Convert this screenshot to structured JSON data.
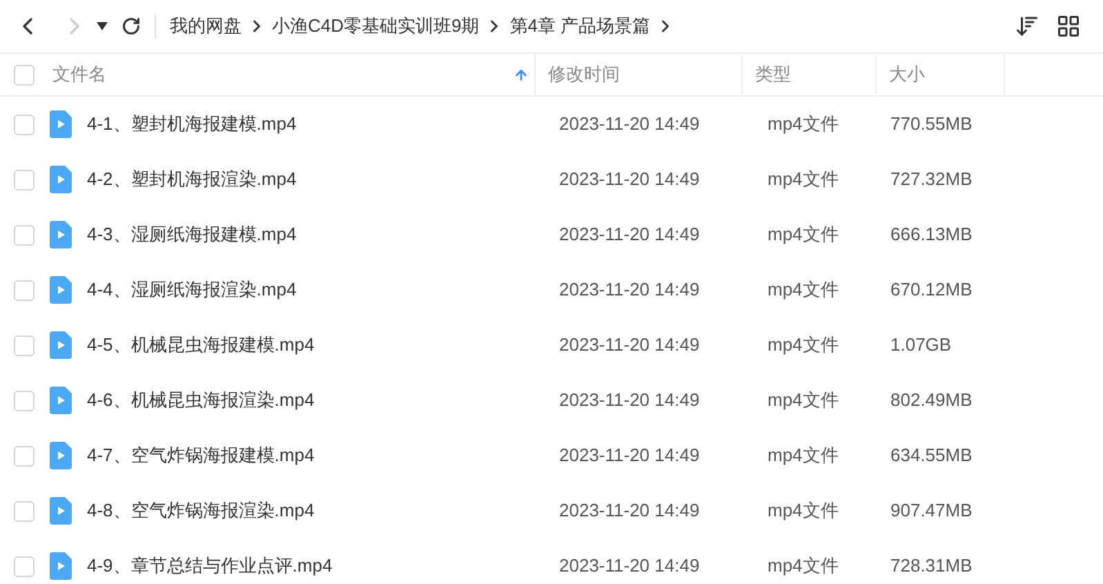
{
  "nav": {
    "back": {
      "disabled": false
    },
    "forward": {
      "disabled": true
    }
  },
  "breadcrumbs": [
    "我的网盘",
    "小渔C4D零基础实训班9期",
    "第4章 产品场景篇"
  ],
  "columns": [
    {
      "label": "文件名",
      "sorted": true
    },
    {
      "label": "修改时间",
      "sorted": false
    },
    {
      "label": "类型",
      "sorted": false
    },
    {
      "label": "大小",
      "sorted": false
    }
  ],
  "select_all": {
    "checked": false
  },
  "rows": [
    {
      "name": "4-1、塑封机海报建模.mp4",
      "modified": "2023-11-20 14:49",
      "type": "mp4文件",
      "size": "770.55MB",
      "checked": false
    },
    {
      "name": "4-2、塑封机海报渲染.mp4",
      "modified": "2023-11-20 14:49",
      "type": "mp4文件",
      "size": "727.32MB",
      "checked": false
    },
    {
      "name": "4-3、湿厕纸海报建模.mp4",
      "modified": "2023-11-20 14:49",
      "type": "mp4文件",
      "size": "666.13MB",
      "checked": false
    },
    {
      "name": "4-4、湿厕纸海报渲染.mp4",
      "modified": "2023-11-20 14:49",
      "type": "mp4文件",
      "size": "670.12MB",
      "checked": false
    },
    {
      "name": "4-5、机械昆虫海报建模.mp4",
      "modified": "2023-11-20 14:49",
      "type": "mp4文件",
      "size": "1.07GB",
      "checked": false
    },
    {
      "name": "4-6、机械昆虫海报渲染.mp4",
      "modified": "2023-11-20 14:49",
      "type": "mp4文件",
      "size": "802.49MB",
      "checked": false
    },
    {
      "name": "4-7、空气炸锅海报建模.mp4",
      "modified": "2023-11-20 14:49",
      "type": "mp4文件",
      "size": "634.55MB",
      "checked": false
    },
    {
      "name": "4-8、空气炸锅海报渲染.mp4",
      "modified": "2023-11-20 14:49",
      "type": "mp4文件",
      "size": "907.47MB",
      "checked": false
    },
    {
      "name": "4-9、章节总结与作业点评.mp4",
      "modified": "2023-11-20 14:49",
      "type": "mp4文件",
      "size": "728.31MB",
      "checked": false
    }
  ]
}
